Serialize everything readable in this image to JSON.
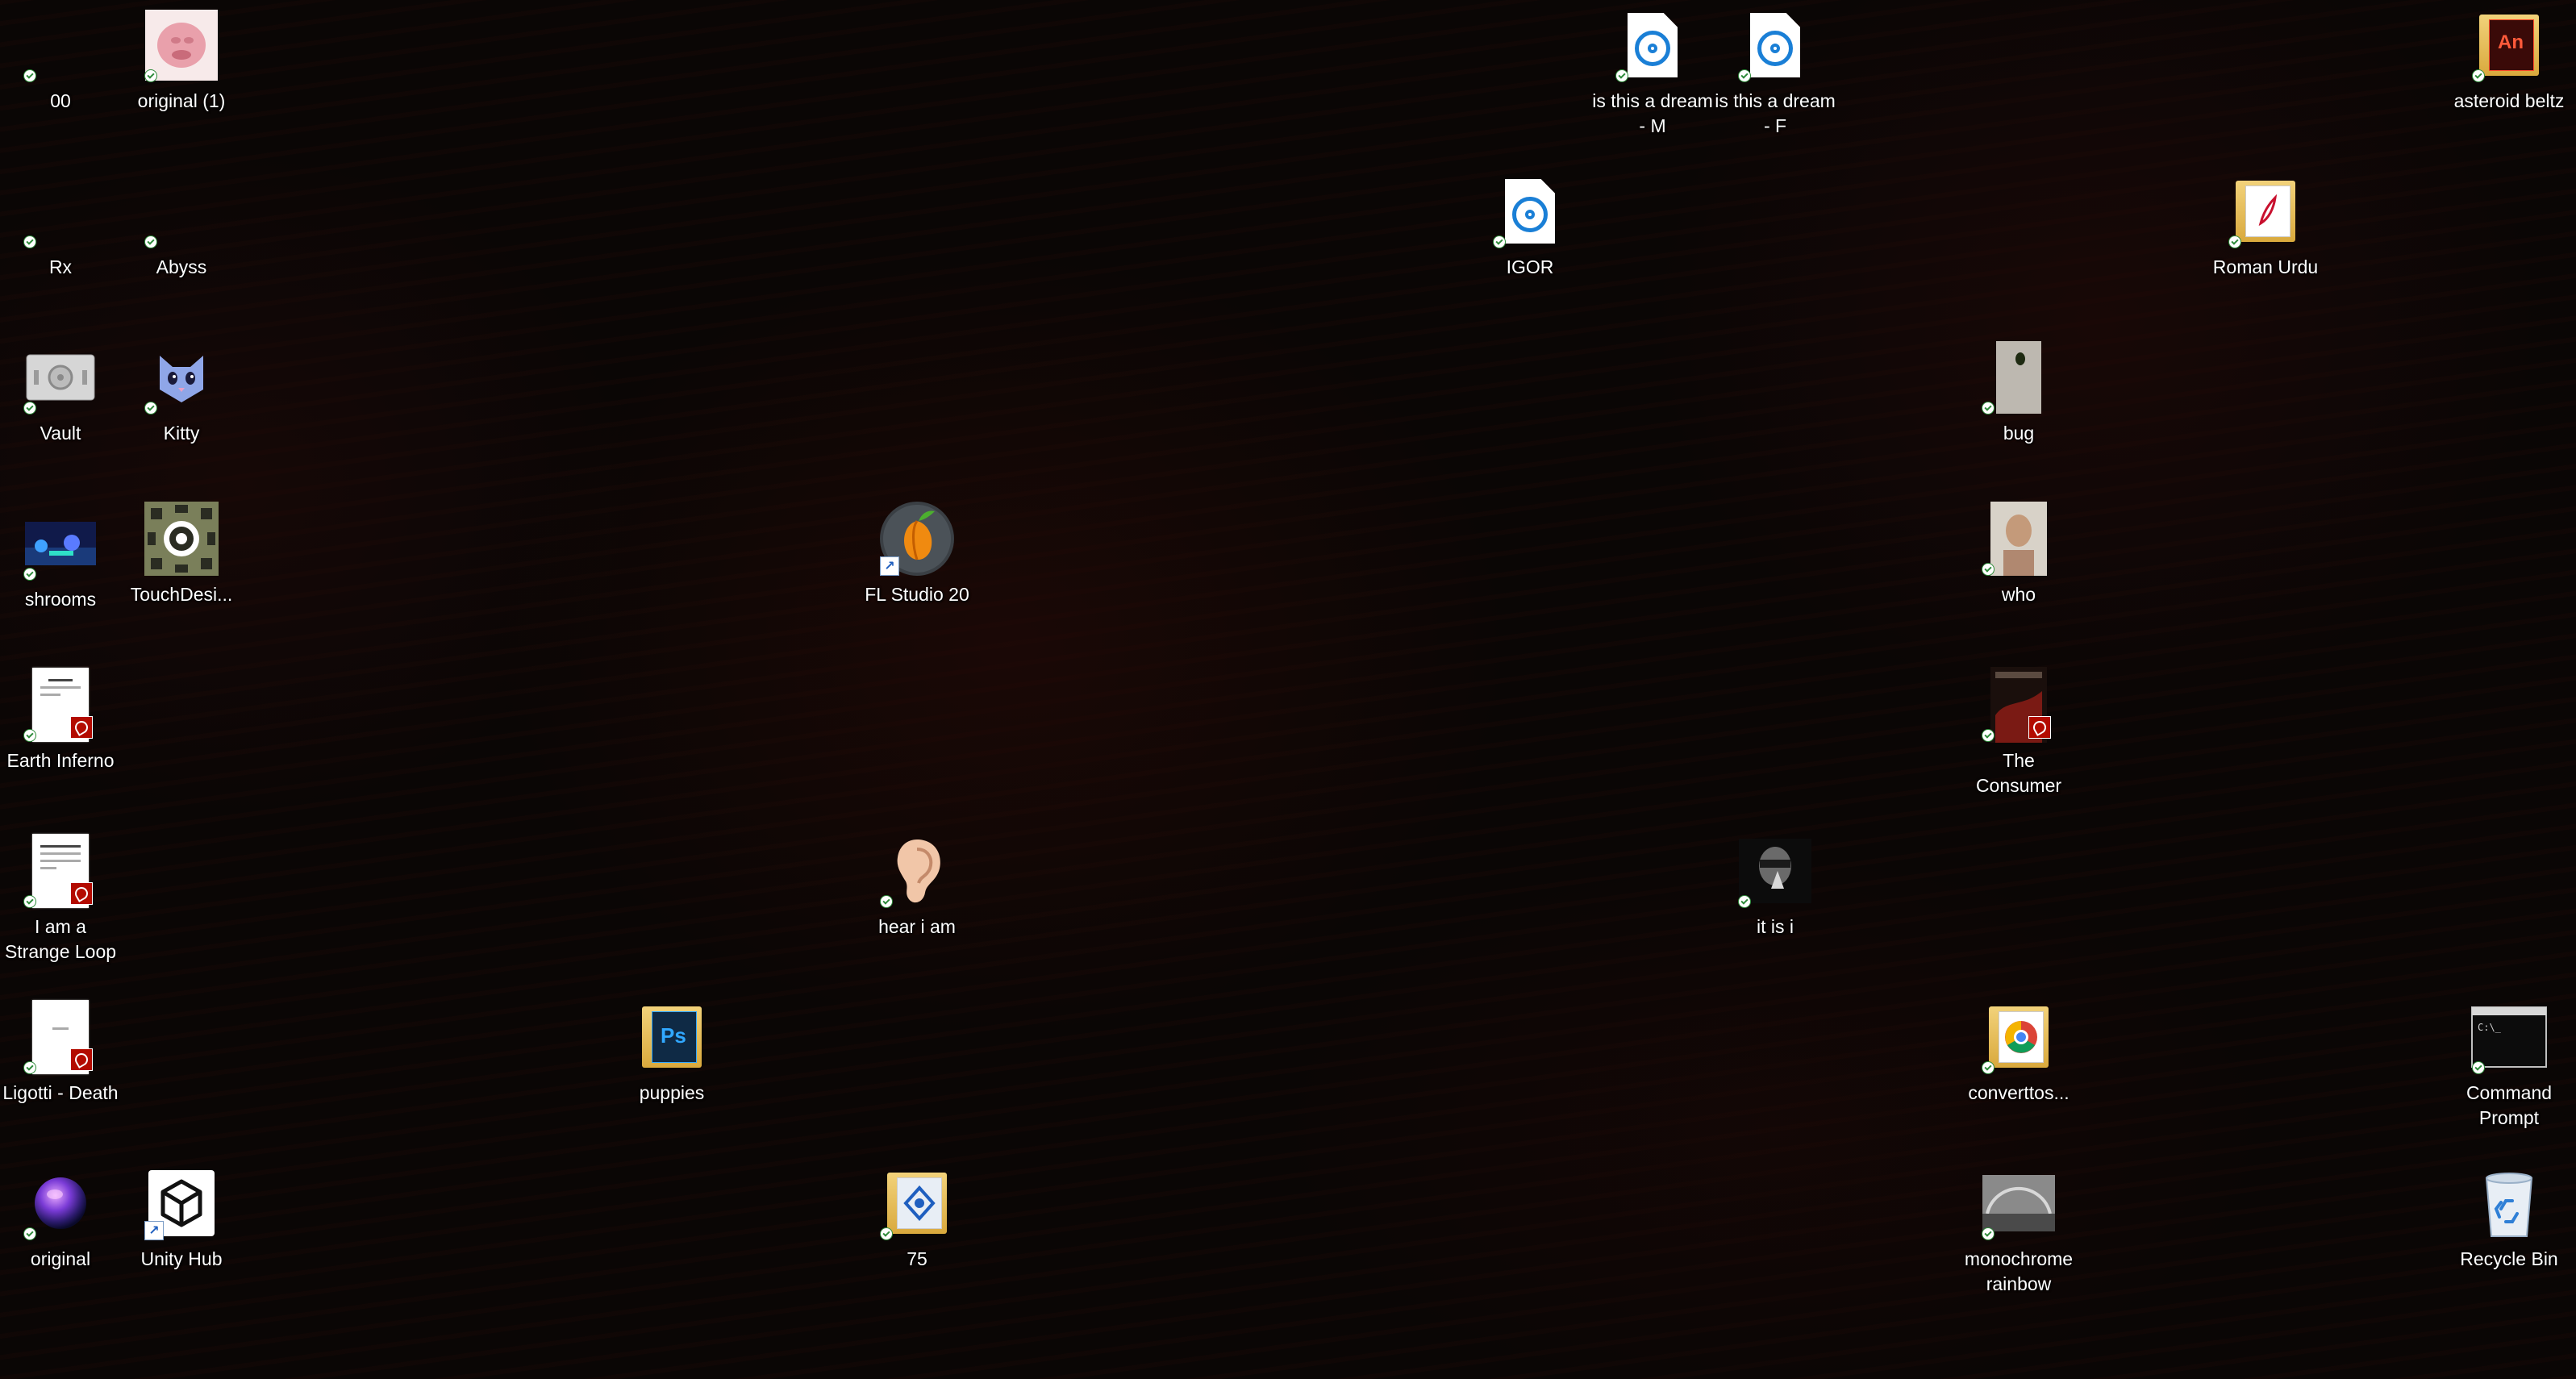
{
  "desktop": {
    "icons": [
      {
        "id": "00",
        "label": "00"
      },
      {
        "id": "original-1",
        "label": "original (1)"
      },
      {
        "id": "rx",
        "label": "Rx"
      },
      {
        "id": "abyss",
        "label": "Abyss"
      },
      {
        "id": "vault",
        "label": "Vault"
      },
      {
        "id": "kitty",
        "label": "Kitty"
      },
      {
        "id": "shrooms",
        "label": "shrooms"
      },
      {
        "id": "touchdesigner",
        "label": "TouchDesi..."
      },
      {
        "id": "earth-inferno",
        "label": "Earth Inferno"
      },
      {
        "id": "strange-loop",
        "label": "I am a Strange Loop"
      },
      {
        "id": "ligotti",
        "label": "Ligotti - Death"
      },
      {
        "id": "original",
        "label": "original"
      },
      {
        "id": "unity-hub",
        "label": "Unity Hub"
      },
      {
        "id": "fl-studio",
        "label": "FL Studio 20"
      },
      {
        "id": "hear-i-am",
        "label": "hear i am"
      },
      {
        "id": "puppies",
        "label": "puppies"
      },
      {
        "id": "seventy-five",
        "label": "75"
      },
      {
        "id": "igor",
        "label": "IGOR"
      },
      {
        "id": "dream-m",
        "label": "is this a dream - M"
      },
      {
        "id": "dream-f",
        "label": "is this a dream - F"
      },
      {
        "id": "it-is-i",
        "label": "it is i"
      },
      {
        "id": "bug",
        "label": "bug"
      },
      {
        "id": "who",
        "label": "who"
      },
      {
        "id": "the-consumer",
        "label": "The Consumer"
      },
      {
        "id": "converttos",
        "label": "converttos..."
      },
      {
        "id": "monochrome-rainbow",
        "label": "monochrome rainbow"
      },
      {
        "id": "roman-urdu",
        "label": "Roman Urdu"
      },
      {
        "id": "asteroid-beltz",
        "label": "asteroid beltz"
      },
      {
        "id": "command-prompt",
        "label": "Command Prompt"
      },
      {
        "id": "recycle-bin",
        "label": "Recycle Bin"
      }
    ]
  },
  "colors": {
    "label_text": "#ffffff",
    "sync_check": "#2e8b3a",
    "pdf_badge": "#b30b00",
    "media_disc": "#1a7fd6"
  }
}
